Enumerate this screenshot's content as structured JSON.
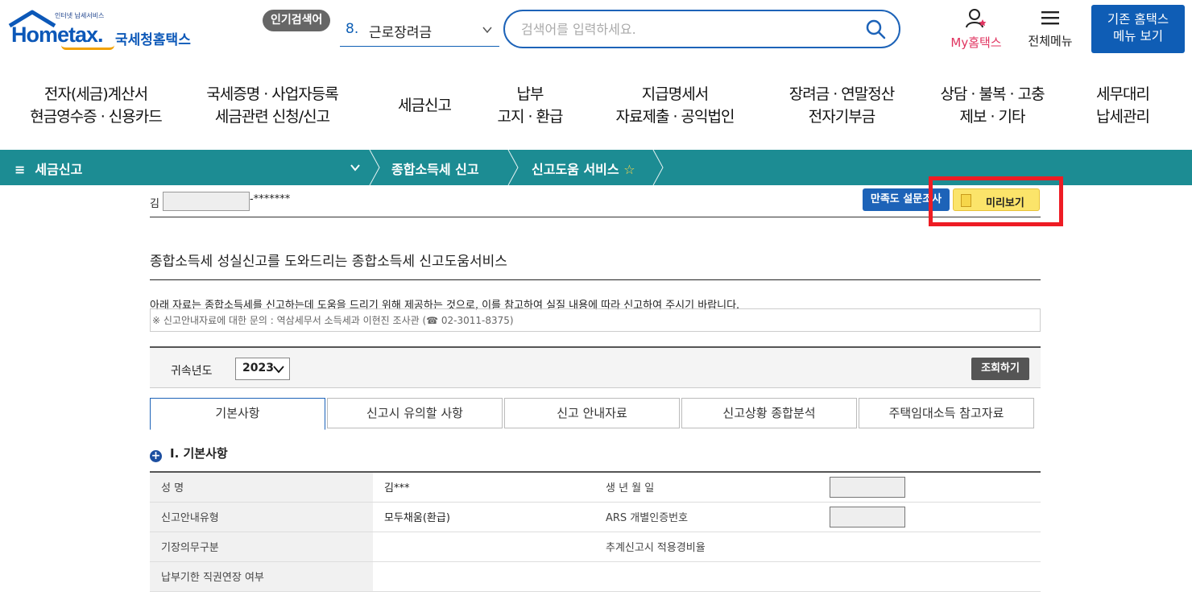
{
  "header": {
    "logo_small_text": "인터넷 납세서비스",
    "logo_brand_text": "Hometax.",
    "logo_korean_text": "국세청홈택스",
    "popular_badge": "인기검색어",
    "popular_rank": "8.",
    "popular_keyword": "근로장려금",
    "search_placeholder": "검색어를 입력하세요.",
    "my_label": "My홈택스",
    "allmenu_label": "전체메뉴",
    "old_btn_line1": "기존 홈택스",
    "old_btn_line2": "메뉴 보기"
  },
  "gnb": [
    {
      "l1": "전자(세금)계산서",
      "l2": "현금영수증 · 신용카드"
    },
    {
      "l1": "국세증명 · 사업자등록",
      "l2": "세금관련 신청/신고"
    },
    {
      "l1": "세금신고",
      "l2": ""
    },
    {
      "l1": "납부",
      "l2": "고지 · 환급"
    },
    {
      "l1": "지급명세서",
      "l2": "자료제출 · 공익법인"
    },
    {
      "l1": "장려금 · 연말정산",
      "l2": "전자기부금"
    },
    {
      "l1": "상담 · 불복 · 고충",
      "l2": "제보 · 기타"
    },
    {
      "l1": "세무대리",
      "l2": "납세관리"
    }
  ],
  "breadcrumb": {
    "menu": "세금신고",
    "level2": "종합소득세 신고",
    "level3": "신고도움 서비스",
    "star": "☆"
  },
  "userbar": {
    "name_prefix": "김",
    "masked": "-*******",
    "survey_btn": "만족도 설문조사",
    "preview_btn": "미리보기"
  },
  "page": {
    "title": "종합소득세 성실신고를 도와드리는 종합소득세 신고도움서비스",
    "notice": "아래 자료는 종합소득세를 신고하는데 도움을 드리기 위해 제공하는 것으로, 이를 참고하여 실질 내용에 따라 신고하여 주시기 바랍니다.",
    "inquiry": "※ 신고안내자료에 대한 문의 : 역삼세무서 소득세과 이현진 조사관 (☎ 02-3011-8375)"
  },
  "year": {
    "label": "귀속년도",
    "value": "2023",
    "search_btn": "조회하기"
  },
  "tabs": [
    "기본사항",
    "신고시 유의할 사항",
    "신고 안내자료",
    "신고상황 종합분석",
    "주택임대소득 참고자료"
  ],
  "section_title": "Ⅰ. 기본사항",
  "info": {
    "r1": {
      "h": "성          명",
      "v": "김***",
      "h2": "생 년 월 일"
    },
    "r2": {
      "h": "신고안내유형",
      "v": "모두채움(환급)",
      "h2": "ARS 개별인증번호"
    },
    "r3": {
      "h": "기장의무구분",
      "v": "",
      "h2": "추계신고시 적용경비율"
    },
    "r4": {
      "h": "납부기한 직권연장 여부",
      "v": ""
    }
  },
  "colors": {
    "brand_blue": "#0f5db5",
    "teal_bar": "#1c8c93",
    "highlight_red": "#ee1c24",
    "preview_yellow": "#fbe46a"
  }
}
